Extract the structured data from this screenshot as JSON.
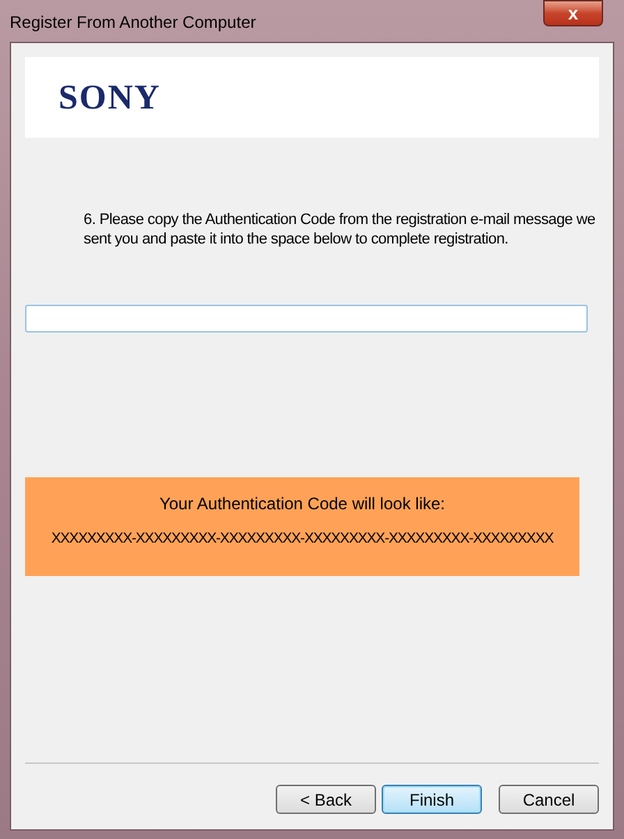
{
  "window": {
    "title": "Register From Another Computer",
    "close_button": "x"
  },
  "logo": "SONY",
  "instructions": "6. Please copy the Authentication Code from the registration e-mail message we sent you and paste it into the space below to complete registration.",
  "example": {
    "heading": "Your Authentication Code will look like:",
    "code": "XXXXXXXXX-XXXXXXXXX-XXXXXXXXX-XXXXXXXXX-XXXXXXXXX-XXXXXXXXX"
  },
  "buttons": [
    {
      "label": "< Back",
      "default": false
    },
    {
      "label": "Finish",
      "default": true
    },
    {
      "label": "Cancel",
      "default": false
    }
  ]
}
